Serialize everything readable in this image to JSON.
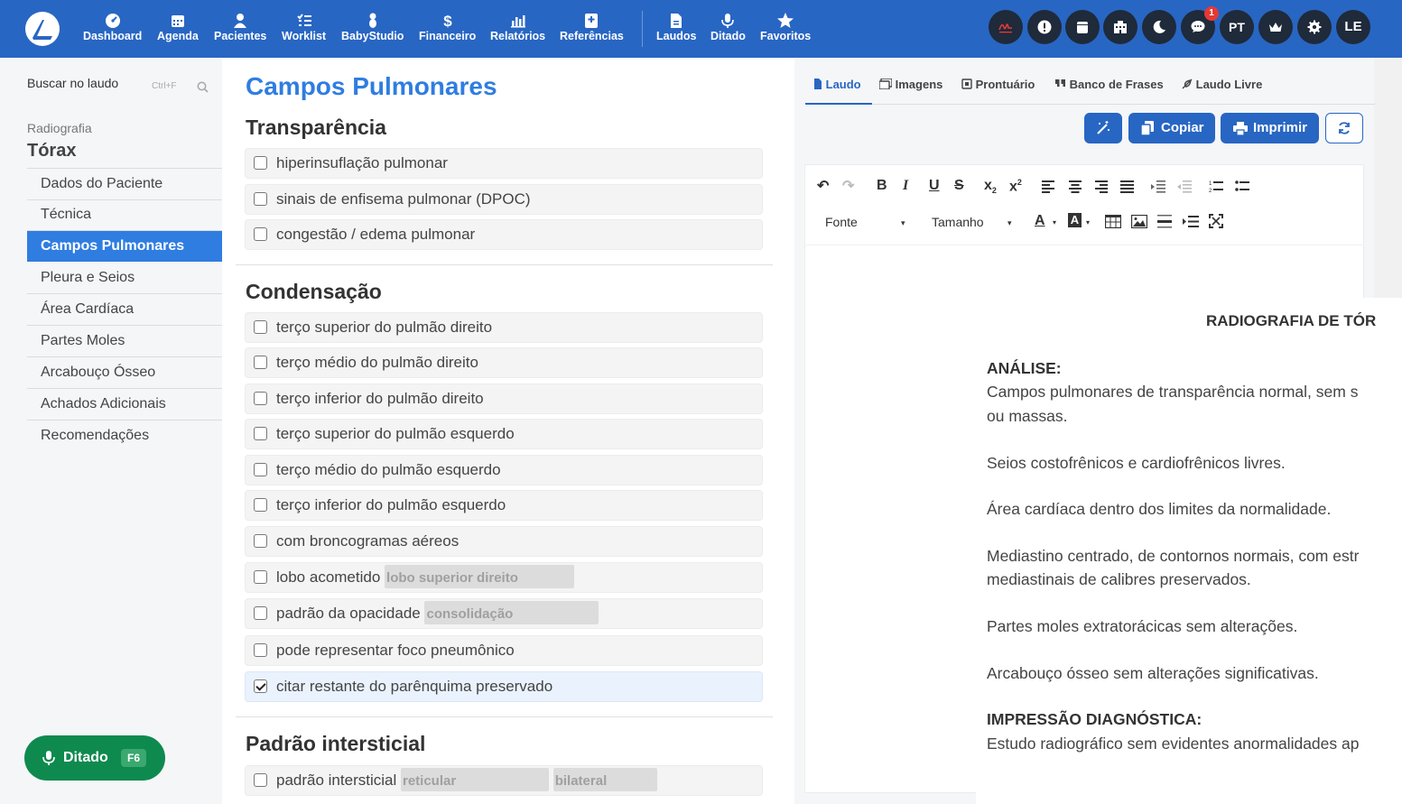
{
  "nav": {
    "items": [
      "Dashboard",
      "Agenda",
      "Pacientes",
      "Worklist",
      "BabyStudio",
      "Financeiro",
      "Relatórios",
      "Referências",
      "Laudos",
      "Ditado",
      "Favoritos"
    ],
    "notif_count": "1",
    "lang": "PT",
    "user": "LE"
  },
  "sidebar": {
    "search_label": "Buscar no laudo",
    "search_shortcut": "Ctrl+F",
    "category": "Radiografia",
    "title": "Tórax",
    "items": [
      "Dados do Paciente",
      "Técnica",
      "Campos Pulmonares",
      "Pleura e Seios",
      "Área Cardíaca",
      "Partes Moles",
      "Arcabouço Ósseo",
      "Achados Adicionais",
      "Recomendações"
    ],
    "active_index": 2,
    "ditado_label": "Ditado",
    "ditado_key": "F6"
  },
  "main": {
    "title": "Campos Pulmonares",
    "sections": [
      {
        "title": "Transparência",
        "options": [
          "hiperinsuflação pulmonar",
          "sinais de enfisema pulmonar (DPOC)",
          "congestão / edema pulmonar"
        ]
      },
      {
        "title": "Condensação",
        "options": [
          "terço superior do pulmão direito",
          "terço médio do pulmão direito",
          "terço inferior do pulmão direito",
          "terço superior do pulmão esquerdo",
          "terço médio do pulmão esquerdo",
          "terço inferior do pulmão esquerdo",
          "com broncogramas aéreos",
          "lobo acometido",
          "padrão da opacidade",
          "pode representar foco pneumônico",
          "citar restante do parênquima preservado"
        ]
      },
      {
        "title": "Padrão intersticial",
        "options": [
          "padrão intersticial"
        ]
      }
    ],
    "chips": {
      "lobo": "lobo superior direito",
      "padrao": "consolidação",
      "intersticial_1": "reticular",
      "intersticial_2": "bilateral"
    }
  },
  "right": {
    "tabs": [
      "Laudo",
      "Imagens",
      "Prontuário",
      "Banco de Frases",
      "Laudo Livre"
    ],
    "copy_label": "Copiar",
    "print_label": "Imprimir",
    "font_label": "Fonte",
    "size_label": "Tamanho",
    "doc": {
      "title": "RADIOGRAFIA DE TÓR",
      "analysis_heading": "ANÁLISE:",
      "lines": [
        "Campos pulmonares de transparência normal, sem s",
        "ou massas.",
        "Seios costofrênicos e cardiofrênicos livres.",
        "Área cardíaca dentro dos limites da normalidade.",
        "Mediastino centrado, de contornos normais, com estr",
        "mediastinais de calibres preservados.",
        "Partes moles extratorácicas sem alterações.",
        "Arcabouço ósseo sem alterações significativas."
      ],
      "impression_heading": "IMPRESSÃO DIAGNÓSTICA:",
      "impression_text": "Estudo radiográfico sem evidentes anormalidades ap"
    }
  },
  "colors": {
    "brand": "#2866c3",
    "active": "#2f7de1",
    "ditado": "#0e8a4f"
  }
}
